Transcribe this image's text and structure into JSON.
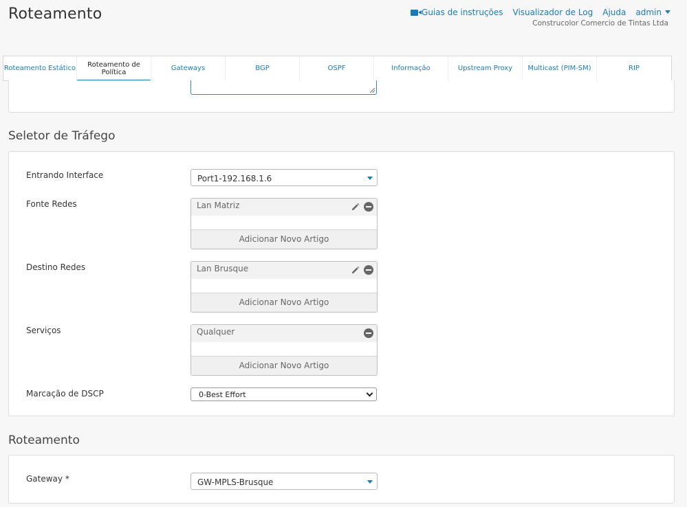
{
  "header": {
    "title": "Roteamento",
    "links": {
      "guides": "Guias de instruções",
      "log_viewer": "Visualizador de Log",
      "help": "Ajuda",
      "user": "admin"
    },
    "company": "Construcolor Comercio de Tintas Ltda"
  },
  "tabs": [
    {
      "label": "Roteamento Estático",
      "active": false
    },
    {
      "label": "Roteamento de Política",
      "active": true
    },
    {
      "label": "Gateways",
      "active": false
    },
    {
      "label": "BGP",
      "active": false
    },
    {
      "label": "OSPF",
      "active": false
    },
    {
      "label": "Informação",
      "active": false
    },
    {
      "label": "Upstream Proxy",
      "active": false
    },
    {
      "label": "Multicast (PIM-SM)",
      "active": false
    },
    {
      "label": "RIP",
      "active": false
    }
  ],
  "traffic_selector": {
    "title": "Seletor de Tráfego",
    "incoming_interface": {
      "label": "Entrando Interface",
      "value": "Port1-192.168.1.6"
    },
    "source_networks": {
      "label": "Fonte Redes",
      "item": "Lan Matriz",
      "add_label": "Adicionar Novo Artigo"
    },
    "destination_networks": {
      "label": "Destino Redes",
      "item": "Lan Brusque",
      "add_label": "Adicionar Novo Artigo"
    },
    "services": {
      "label": "Serviços",
      "item": "Qualquer",
      "add_label": "Adicionar Novo Artigo"
    },
    "dscp": {
      "label": "Marcação de DSCP",
      "value": "0-Best Effort"
    }
  },
  "routing": {
    "title": "Roteamento",
    "gateway": {
      "label": "Gateway *",
      "value": "GW-MPLS-Brusque"
    }
  },
  "colors": {
    "accent": "#1a7bb9",
    "background": "#f7f7f7",
    "panel": "#ffffff"
  }
}
